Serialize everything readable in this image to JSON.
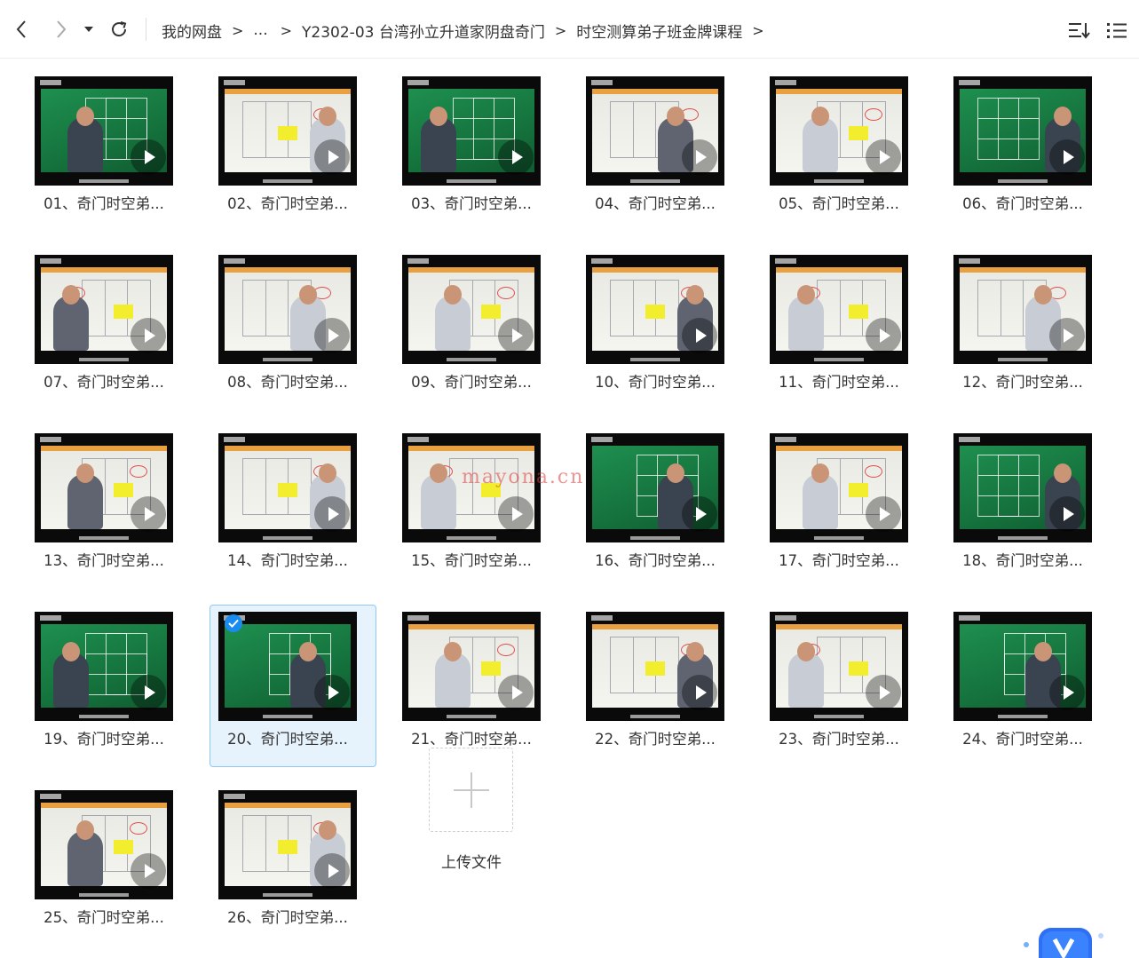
{
  "toolbar": {
    "back_icon": "chevron-left-icon",
    "forward_icon": "chevron-right-icon",
    "history_icon": "caret-down-icon",
    "refresh_icon": "refresh-icon",
    "sort_icon": "sort-icon",
    "view_icon": "list-view-icon"
  },
  "breadcrumb": {
    "items": [
      "我的网盘",
      "...",
      "Y2302-03 台湾孙立升道家阴盘奇门",
      "时空测算弟子班金牌课程"
    ],
    "separator": ">"
  },
  "files": [
    {
      "title": "01、奇门时空弟...",
      "theme": "green"
    },
    {
      "title": "02、奇门时空弟...",
      "theme": "white"
    },
    {
      "title": "03、奇门时空弟...",
      "theme": "green"
    },
    {
      "title": "04、奇门时空弟...",
      "theme": "white"
    },
    {
      "title": "05、奇门时空弟...",
      "theme": "white"
    },
    {
      "title": "06、奇门时空弟...",
      "theme": "green"
    },
    {
      "title": "07、奇门时空弟...",
      "theme": "white"
    },
    {
      "title": "08、奇门时空弟...",
      "theme": "white"
    },
    {
      "title": "09、奇门时空弟...",
      "theme": "white"
    },
    {
      "title": "10、奇门时空弟...",
      "theme": "white"
    },
    {
      "title": "11、奇门时空弟...",
      "theme": "white"
    },
    {
      "title": "12、奇门时空弟...",
      "theme": "white"
    },
    {
      "title": "13、奇门时空弟...",
      "theme": "white"
    },
    {
      "title": "14、奇门时空弟...",
      "theme": "white"
    },
    {
      "title": "15、奇门时空弟...",
      "theme": "white"
    },
    {
      "title": "16、奇门时空弟...",
      "theme": "green"
    },
    {
      "title": "17、奇门时空弟...",
      "theme": "white"
    },
    {
      "title": "18、奇门时空弟...",
      "theme": "green"
    },
    {
      "title": "19、奇门时空弟...",
      "theme": "green"
    },
    {
      "title": "20、奇门时空弟...",
      "theme": "green",
      "selected": true
    },
    {
      "title": "21、奇门时空弟...",
      "theme": "white"
    },
    {
      "title": "22、奇门时空弟...",
      "theme": "white"
    },
    {
      "title": "23、奇门时空弟...",
      "theme": "white"
    },
    {
      "title": "24、奇门时空弟...",
      "theme": "green"
    },
    {
      "title": "25、奇门时空弟...",
      "theme": "white"
    },
    {
      "title": "26、奇门时空弟...",
      "theme": "white"
    }
  ],
  "upload": {
    "label": "上传文件",
    "icon": "plus-icon"
  },
  "watermark": "mayona.cn",
  "colors": {
    "accent": "#1a8cf0",
    "selected_bg": "#e6f3fd",
    "selected_border": "#8fc8f4"
  }
}
